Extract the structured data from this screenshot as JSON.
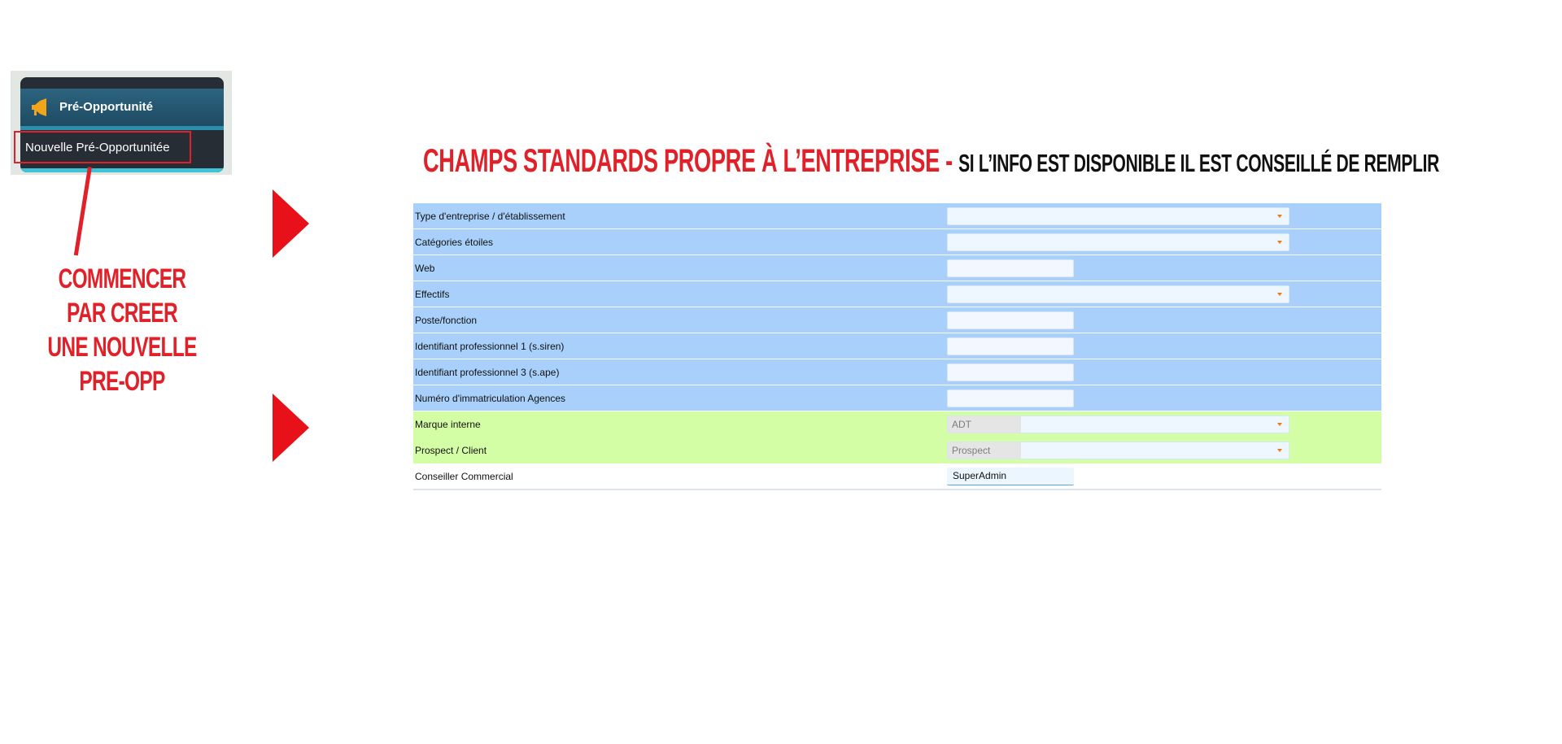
{
  "menu": {
    "section_title": "Pré-Opportunité",
    "section_icon": "megaphone-icon",
    "item_label": "Nouvelle Pré-Opportunitée"
  },
  "callout": {
    "line1": "COMMENCER PAR CREER",
    "line2": "UNE NOUVELLE PRE-OPP"
  },
  "heading": {
    "red": "CHAMPS STANDARDS PROPRE À L’ENTREPRISE - ",
    "black": "SI L’INFO EST DISPONIBLE IL EST CONSEILLÉ DE REMPLIR"
  },
  "form": {
    "rows": [
      {
        "label": "Type d'entreprise / d'établissement",
        "control": "select",
        "value": ""
      },
      {
        "label": "Catégories étoiles",
        "control": "select",
        "value": ""
      },
      {
        "label": "Web",
        "control": "text",
        "value": ""
      },
      {
        "label": "Effectifs",
        "control": "select",
        "value": ""
      },
      {
        "label": "Poste/fonction",
        "control": "text",
        "value": ""
      },
      {
        "label": "Identifiant professionnel 1 (s.siren)",
        "control": "text",
        "value": ""
      },
      {
        "label": "Identifiant professionnel 3 (s.ape)",
        "control": "text",
        "value": ""
      },
      {
        "label": "Numéro d'immatriculation Agences",
        "control": "text",
        "value": ""
      },
      {
        "label": "Marque interne",
        "control": "select",
        "value": "ADT"
      },
      {
        "label": "Prospect / Client",
        "control": "select",
        "value": "Prospect"
      },
      {
        "label": "Conseiller Commercial",
        "control": "text",
        "value": "SuperAdmin"
      }
    ]
  },
  "colors": {
    "accent_red": "#e1212a",
    "row_blue": "#a8d0fa",
    "row_green": "#d4fea5",
    "caret_orange": "#f07a12"
  }
}
